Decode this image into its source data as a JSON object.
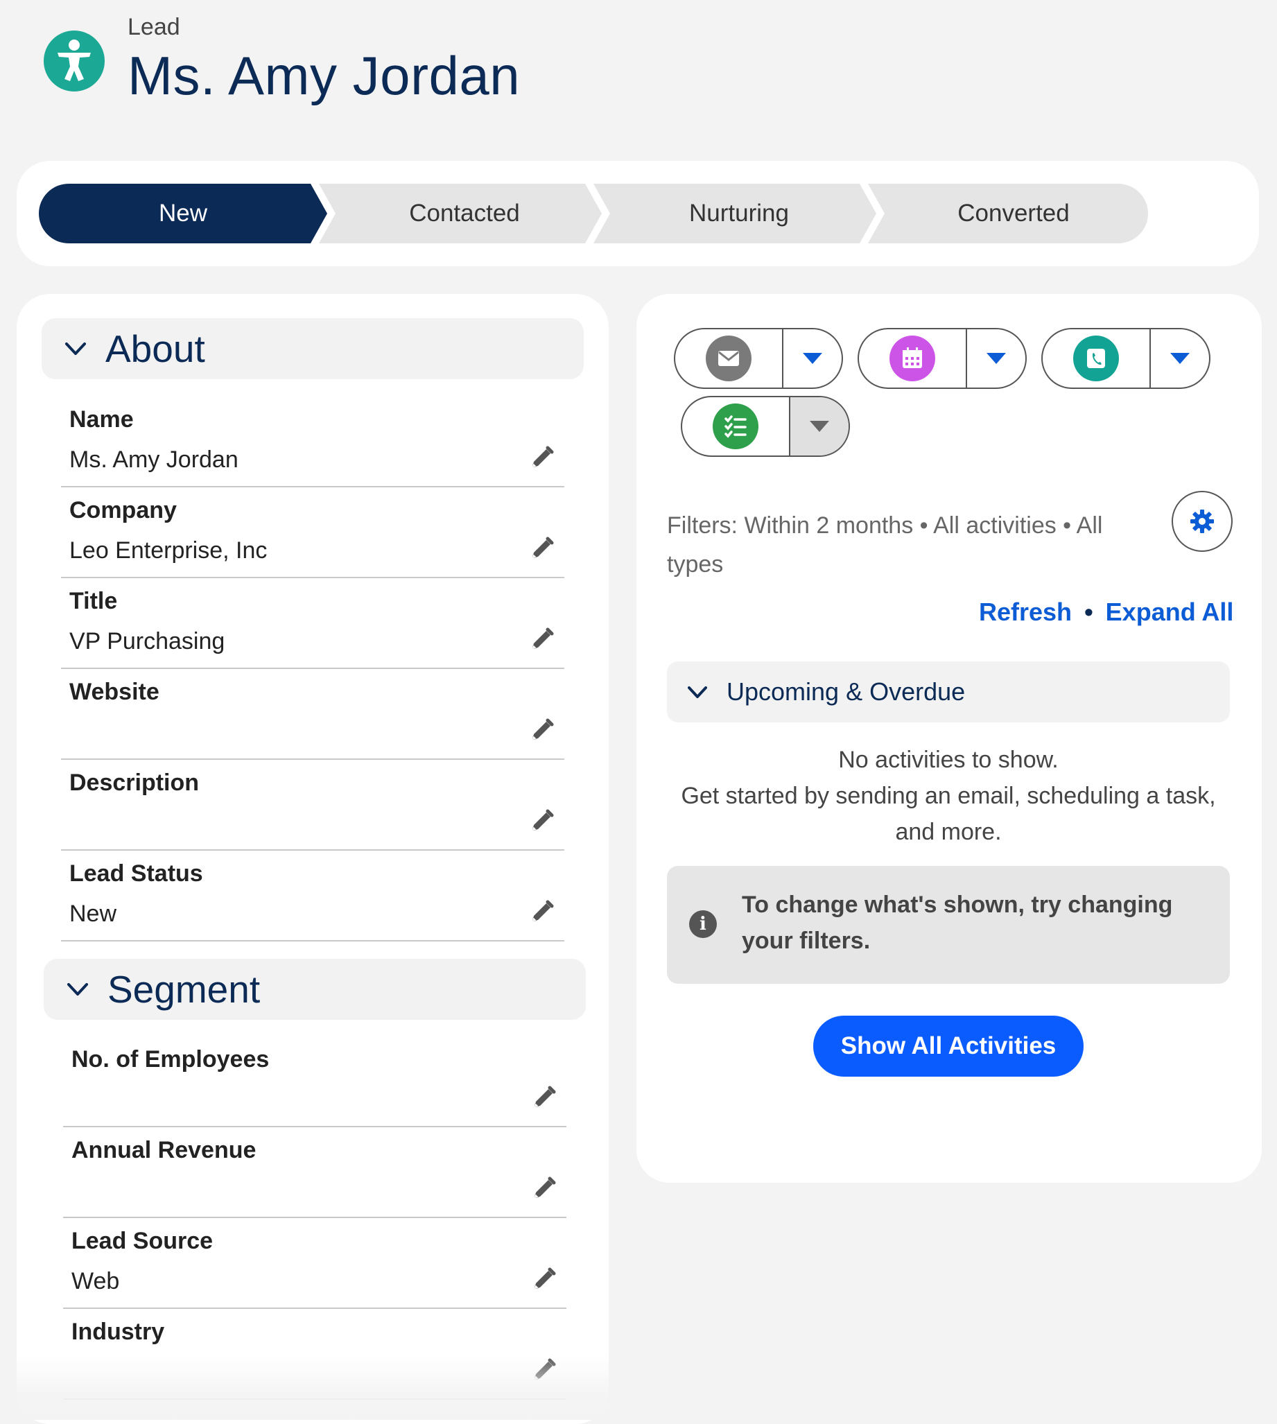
{
  "header": {
    "object_label": "Lead",
    "record_name": "Ms. Amy Jordan",
    "icon": "lead-person-icon"
  },
  "path": {
    "steps": [
      {
        "label": "New",
        "active": true
      },
      {
        "label": "Contacted",
        "active": false
      },
      {
        "label": "Nurturing",
        "active": false
      },
      {
        "label": "Converted",
        "active": false
      }
    ]
  },
  "about": {
    "title": "About",
    "fields": [
      {
        "label": "Name",
        "value": "Ms. Amy Jordan"
      },
      {
        "label": "Company",
        "value": "Leo Enterprise, Inc"
      },
      {
        "label": "Title",
        "value": "VP Purchasing"
      },
      {
        "label": "Website",
        "value": ""
      },
      {
        "label": "Description",
        "value": ""
      },
      {
        "label": "Lead Status",
        "value": "New"
      }
    ]
  },
  "segment": {
    "title": "Segment",
    "fields": [
      {
        "label": "No. of Employees",
        "value": ""
      },
      {
        "label": "Annual Revenue",
        "value": ""
      },
      {
        "label": "Lead Source",
        "value": "Web"
      },
      {
        "label": "Industry",
        "value": ""
      }
    ]
  },
  "activity": {
    "buttons": [
      {
        "icon": "email-icon",
        "color": "#7a7a7a"
      },
      {
        "icon": "calendar-event-icon",
        "color": "#cc55e8"
      },
      {
        "icon": "log-call-icon",
        "color": "#13a394"
      },
      {
        "icon": "new-task-icon",
        "color": "#2e9f4b"
      }
    ],
    "filters_text": "Filters: Within 2 months • All activities • All types",
    "refresh_label": "Refresh",
    "separator": "•",
    "expand_all_label": "Expand All",
    "upcoming_title": "Upcoming & Overdue",
    "empty_line1": "No activities to show.",
    "empty_line2": "Get started by sending an email, scheduling a task, and more.",
    "tip_text": "To change what's shown, try changing your filters.",
    "show_all_label": "Show All Activities"
  },
  "colors": {
    "brand_navy": "#0b2a55",
    "link_blue": "#0b5cd5",
    "button_blue": "#0b5cff",
    "lead_icon": "#1ba894"
  }
}
